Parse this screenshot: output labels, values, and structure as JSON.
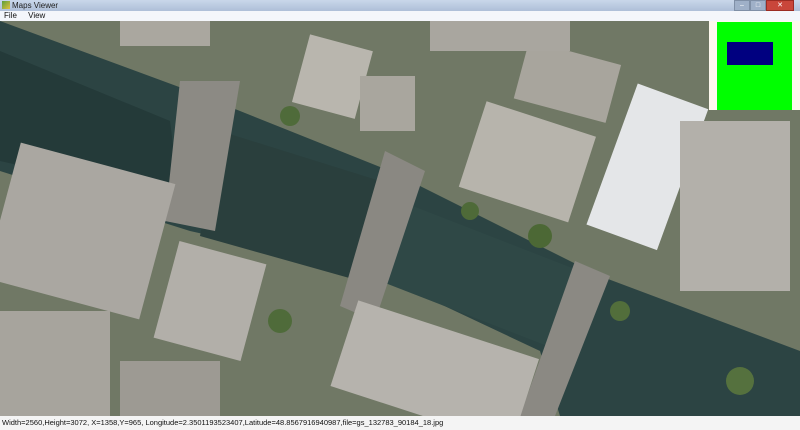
{
  "window": {
    "title": "Maps Viewer",
    "minimize": "–",
    "maximize": "□",
    "close": "✕"
  },
  "menu": {
    "items": [
      {
        "label": "File"
      },
      {
        "label": "View"
      }
    ]
  },
  "map": {
    "icon": "aerial-map-image"
  },
  "minimap": {
    "background_color": "#00ff00",
    "viewport_color": "#000080"
  },
  "status": {
    "text": "Width=2560,Height=3072, X=1358,Y=965, Longitude=2.3501193523407,Latitude=48.8567916940987,file=gs_132783_90184_18.jpg"
  }
}
